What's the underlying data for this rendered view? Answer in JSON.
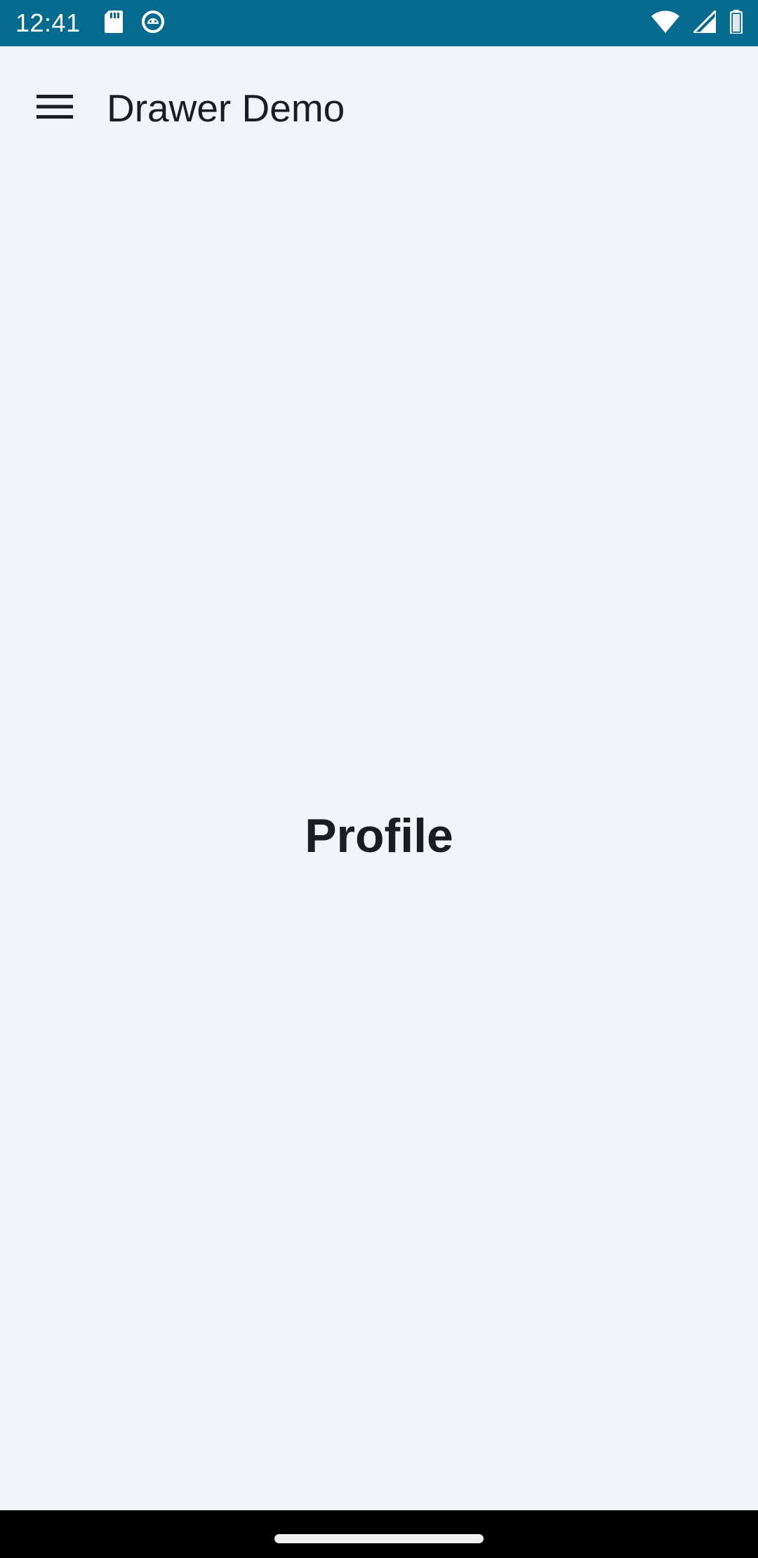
{
  "status_bar": {
    "time": "12:41",
    "left_icons": [
      "sd-card-icon",
      "android-debug-icon"
    ],
    "right_icons": [
      "wifi-icon",
      "cell-signal-icon",
      "battery-icon"
    ],
    "background_color": "#046a8e"
  },
  "app_bar": {
    "menu_icon": "hamburger-menu-icon",
    "title": "Drawer Demo"
  },
  "main": {
    "heading": "Profile",
    "background_color": "#f1f4f9"
  },
  "navigation": {
    "home_indicator": "home-gesture-handle"
  }
}
